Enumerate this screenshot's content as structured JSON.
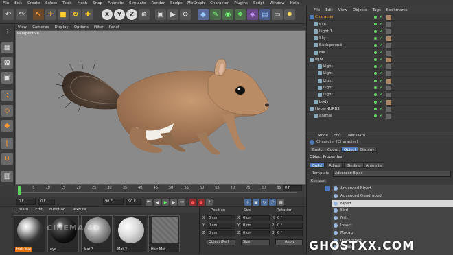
{
  "menubar": [
    "File",
    "Edit",
    "Create",
    "Select",
    "Tools",
    "Mesh",
    "Snap",
    "Animate",
    "Simulate",
    "Render",
    "Sculpt",
    "MoGraph",
    "Character",
    "Plugins",
    "Script",
    "Window",
    "Help"
  ],
  "viewport_menu": [
    "View",
    "Cameras",
    "Display",
    "Options",
    "Filter",
    "Panel"
  ],
  "viewport_label": "Perspective",
  "timeline_ticks": [
    "0",
    "5",
    "10",
    "15",
    "20",
    "25",
    "30",
    "35",
    "40",
    "45",
    "50",
    "55",
    "60",
    "65",
    "70",
    "75",
    "80",
    "85",
    "90"
  ],
  "playbar": {
    "start": "0 F",
    "current": "0 F",
    "end": "90 F",
    "end2": "90 F",
    "frame_readout": "0 F"
  },
  "material_menu": [
    "Create",
    "Edit",
    "Function",
    "Texture"
  ],
  "materials": [
    {
      "label": "Hair Mat",
      "highlight": true
    },
    {
      "label": "eye",
      "highlight": false
    },
    {
      "label": "Mat.3",
      "highlight": false
    },
    {
      "label": "Mat.2",
      "highlight": false
    },
    {
      "label": "Hair Mat",
      "highlight": false
    }
  ],
  "coords": {
    "headers": [
      "Position",
      "Size",
      "Rotation"
    ],
    "rows": [
      {
        "axis": "X",
        "pos": "0 cm",
        "size_axis": "X",
        "size": "0 cm",
        "rot_axis": "H",
        "rot": "0 °"
      },
      {
        "axis": "Y",
        "pos": "0 cm",
        "size_axis": "Y",
        "size": "0 cm",
        "rot_axis": "P",
        "rot": "0 °"
      },
      {
        "axis": "Z",
        "pos": "0 cm",
        "size_axis": "Z",
        "size": "0 cm",
        "rot_axis": "B",
        "rot": "0 °"
      }
    ],
    "mode": "Object (Rel)",
    "size_mode": "Size",
    "apply": "Apply"
  },
  "object_menu": [
    "File",
    "Edit",
    "View",
    "Objects",
    "Tags",
    "Bookmarks"
  ],
  "objects": [
    {
      "name": "Character",
      "indent": 0,
      "color": "#f5a623"
    },
    {
      "name": "eye",
      "indent": 1,
      "color": "#ddd"
    },
    {
      "name": "Light.1",
      "indent": 1,
      "color": "#ddd"
    },
    {
      "name": "Sky",
      "indent": 1,
      "color": "#ddd"
    },
    {
      "name": "Background",
      "indent": 1,
      "color": "#ddd"
    },
    {
      "name": "tail",
      "indent": 1,
      "color": "#ddd"
    },
    {
      "name": "light",
      "indent": 0,
      "color": "#ddd"
    },
    {
      "name": "Light",
      "indent": 2,
      "color": "#ddd"
    },
    {
      "name": "Light",
      "indent": 2,
      "color": "#ddd"
    },
    {
      "name": "Light",
      "indent": 2,
      "color": "#ddd"
    },
    {
      "name": "Light",
      "indent": 2,
      "color": "#ddd"
    },
    {
      "name": "Light",
      "indent": 2,
      "color": "#ddd"
    },
    {
      "name": "body",
      "indent": 1,
      "color": "#ddd"
    },
    {
      "name": "HyperNURBS",
      "indent": 0,
      "color": "#ddd"
    },
    {
      "name": "animal",
      "indent": 1,
      "color": "#ddd"
    }
  ],
  "attr_menu": [
    "Mode",
    "Edit",
    "User Data"
  ],
  "attr_title": "Character [Character]",
  "attr_tabs": [
    {
      "label": "Basic",
      "sel": false
    },
    {
      "label": "Coord.",
      "sel": false
    },
    {
      "label": "Object",
      "sel": true
    },
    {
      "label": "Display",
      "sel": false
    }
  ],
  "object_properties": "Object Properties",
  "sub_tabs": [
    {
      "label": "Build",
      "sel": true
    },
    {
      "label": "Adjust",
      "sel": false
    },
    {
      "label": "Binding",
      "sel": false
    },
    {
      "label": "Animate",
      "sel": false
    }
  ],
  "template_label": "Template",
  "template_value": "Advanced Biped",
  "components_label": "Compon",
  "dropdown_items": [
    {
      "label": "Advanced Biped",
      "highlight": false
    },
    {
      "label": "Advanced Quadruped",
      "highlight": false
    },
    {
      "label": "Biped",
      "highlight": true
    },
    {
      "label": "Bird",
      "highlight": false
    },
    {
      "label": "Fish",
      "highlight": false
    },
    {
      "label": "Insect",
      "highlight": false
    },
    {
      "label": "Mocap",
      "highlight": false
    },
    {
      "label": "Quadruped",
      "highlight": false
    },
    {
      "label": "Reptile",
      "highlight": false
    }
  ],
  "watermark": "GHOSTXX.COM",
  "material_watermark": "CINEMA 4D"
}
